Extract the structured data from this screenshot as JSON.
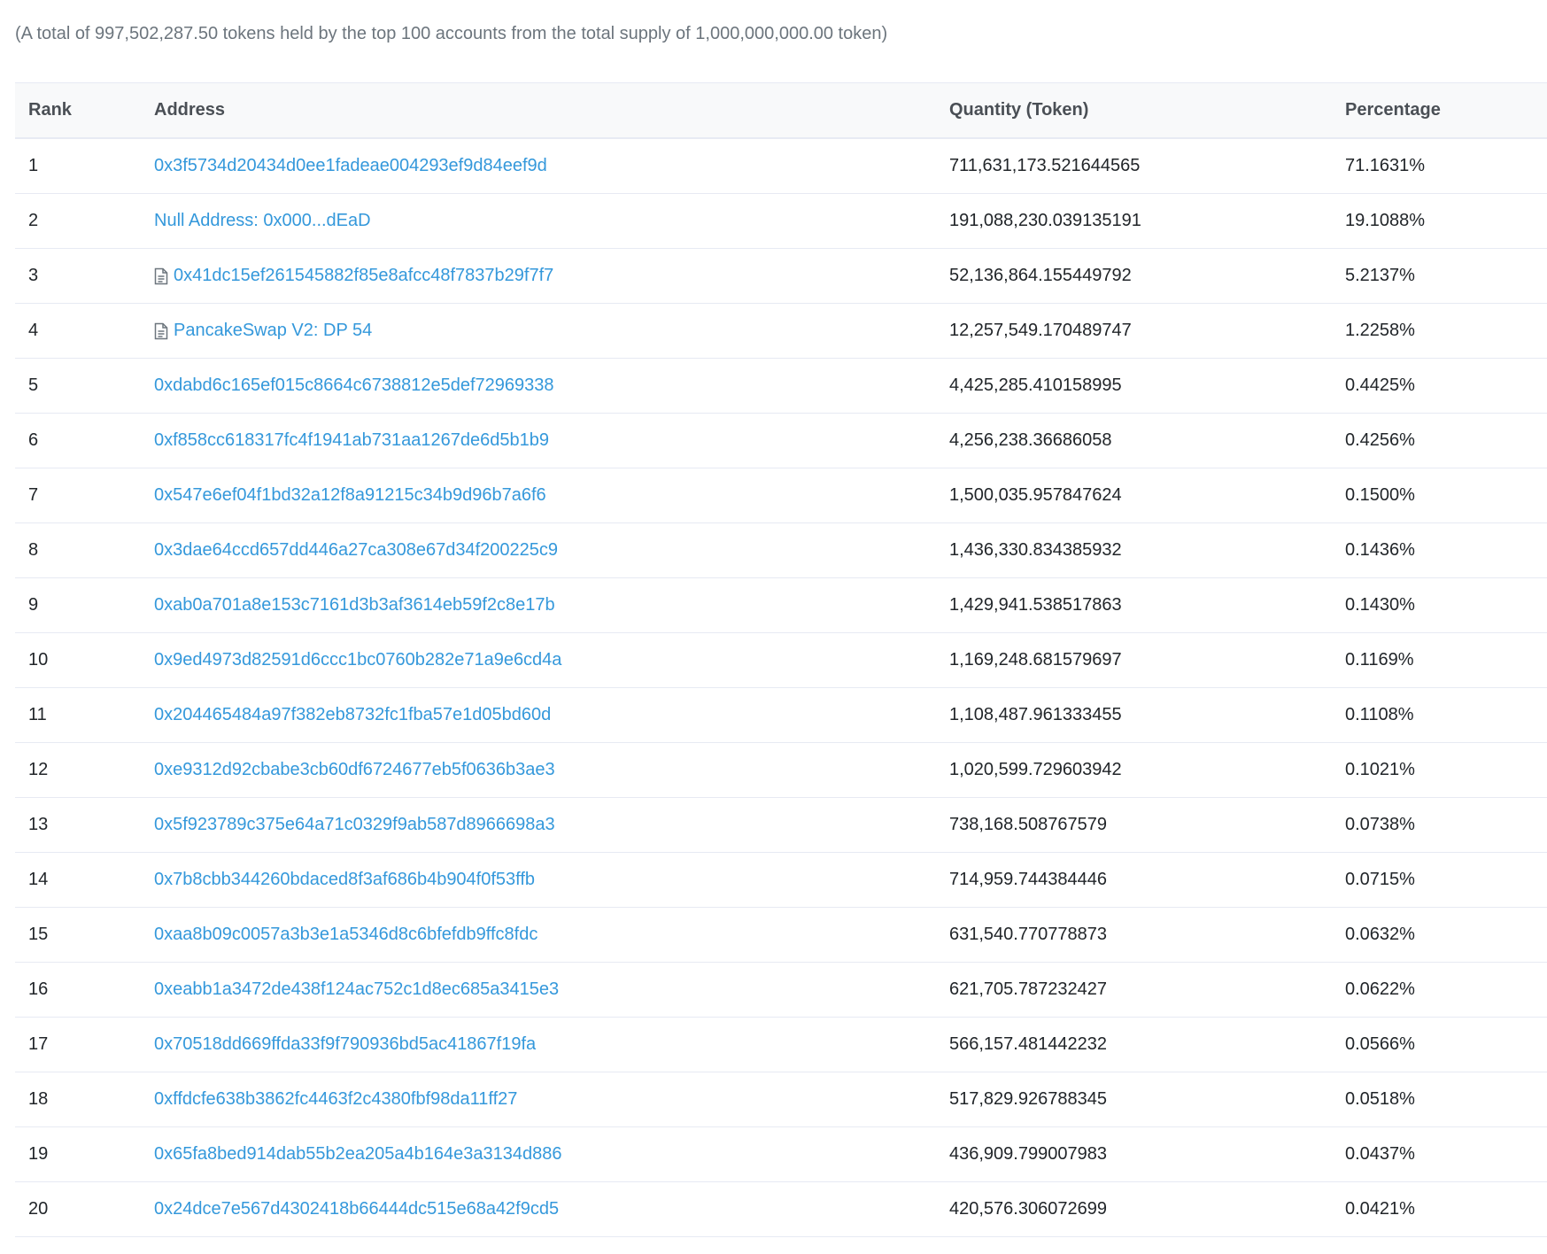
{
  "summary": "(A total of 997,502,287.50 tokens held by the top 100 accounts from the total supply of 1,000,000,000.00 token)",
  "columns": {
    "rank": "Rank",
    "address": "Address",
    "quantity": "Quantity (Token)",
    "percentage": "Percentage"
  },
  "rows": [
    {
      "rank": "1",
      "address": "0x3f5734d20434d0ee1fadeae004293ef9d84eef9d",
      "quantity": "711,631,173.521644565",
      "percentage": "71.1631%",
      "icon": ""
    },
    {
      "rank": "2",
      "address": "Null Address: 0x000...dEaD",
      "quantity": "191,088,230.039135191",
      "percentage": "19.1088%",
      "icon": ""
    },
    {
      "rank": "3",
      "address": "0x41dc15ef261545882f85e8afcc48f7837b29f7f7",
      "quantity": "52,136,864.155449792",
      "percentage": "5.2137%",
      "icon": "contract-icon"
    },
    {
      "rank": "4",
      "address": "PancakeSwap V2: DP 54",
      "quantity": "12,257,549.170489747",
      "percentage": "1.2258%",
      "icon": "contract-icon"
    },
    {
      "rank": "5",
      "address": "0xdabd6c165ef015c8664c6738812e5def72969338",
      "quantity": "4,425,285.410158995",
      "percentage": "0.4425%",
      "icon": ""
    },
    {
      "rank": "6",
      "address": "0xf858cc618317fc4f1941ab731aa1267de6d5b1b9",
      "quantity": "4,256,238.36686058",
      "percentage": "0.4256%",
      "icon": ""
    },
    {
      "rank": "7",
      "address": "0x547e6ef04f1bd32a12f8a91215c34b9d96b7a6f6",
      "quantity": "1,500,035.957847624",
      "percentage": "0.1500%",
      "icon": ""
    },
    {
      "rank": "8",
      "address": "0x3dae64ccd657dd446a27ca308e67d34f200225c9",
      "quantity": "1,436,330.834385932",
      "percentage": "0.1436%",
      "icon": ""
    },
    {
      "rank": "9",
      "address": "0xab0a701a8e153c7161d3b3af3614eb59f2c8e17b",
      "quantity": "1,429,941.538517863",
      "percentage": "0.1430%",
      "icon": ""
    },
    {
      "rank": "10",
      "address": "0x9ed4973d82591d6ccc1bc0760b282e71a9e6cd4a",
      "quantity": "1,169,248.681579697",
      "percentage": "0.1169%",
      "icon": ""
    },
    {
      "rank": "11",
      "address": "0x204465484a97f382eb8732fc1fba57e1d05bd60d",
      "quantity": "1,108,487.961333455",
      "percentage": "0.1108%",
      "icon": ""
    },
    {
      "rank": "12",
      "address": "0xe9312d92cbabe3cb60df6724677eb5f0636b3ae3",
      "quantity": "1,020,599.729603942",
      "percentage": "0.1021%",
      "icon": ""
    },
    {
      "rank": "13",
      "address": "0x5f923789c375e64a71c0329f9ab587d8966698a3",
      "quantity": "738,168.508767579",
      "percentage": "0.0738%",
      "icon": ""
    },
    {
      "rank": "14",
      "address": "0x7b8cbb344260bdaced8f3af686b4b904f0f53ffb",
      "quantity": "714,959.744384446",
      "percentage": "0.0715%",
      "icon": ""
    },
    {
      "rank": "15",
      "address": "0xaa8b09c0057a3b3e1a5346d8c6bfefdb9ffc8fdc",
      "quantity": "631,540.770778873",
      "percentage": "0.0632%",
      "icon": ""
    },
    {
      "rank": "16",
      "address": "0xeabb1a3472de438f124ac752c1d8ec685a3415e3",
      "quantity": "621,705.787232427",
      "percentage": "0.0622%",
      "icon": ""
    },
    {
      "rank": "17",
      "address": "0x70518dd669ffda33f9f790936bd5ac41867f19fa",
      "quantity": "566,157.481442232",
      "percentage": "0.0566%",
      "icon": ""
    },
    {
      "rank": "18",
      "address": "0xffdcfe638b3862fc4463f2c4380fbf98da11ff27",
      "quantity": "517,829.926788345",
      "percentage": "0.0518%",
      "icon": ""
    },
    {
      "rank": "19",
      "address": "0x65fa8bed914dab55b2ea205a4b164e3a3134d886",
      "quantity": "436,909.799007983",
      "percentage": "0.0437%",
      "icon": ""
    },
    {
      "rank": "20",
      "address": "0x24dce7e567d4302418b66444dc515e68a42f9cd5",
      "quantity": "420,576.306072699",
      "percentage": "0.0421%",
      "icon": ""
    }
  ],
  "colors": {
    "link": "#3498db",
    "text": "#212529",
    "muted": "#6c757d",
    "border": "#e7eaf3",
    "header_bg": "#f8f9fa"
  }
}
